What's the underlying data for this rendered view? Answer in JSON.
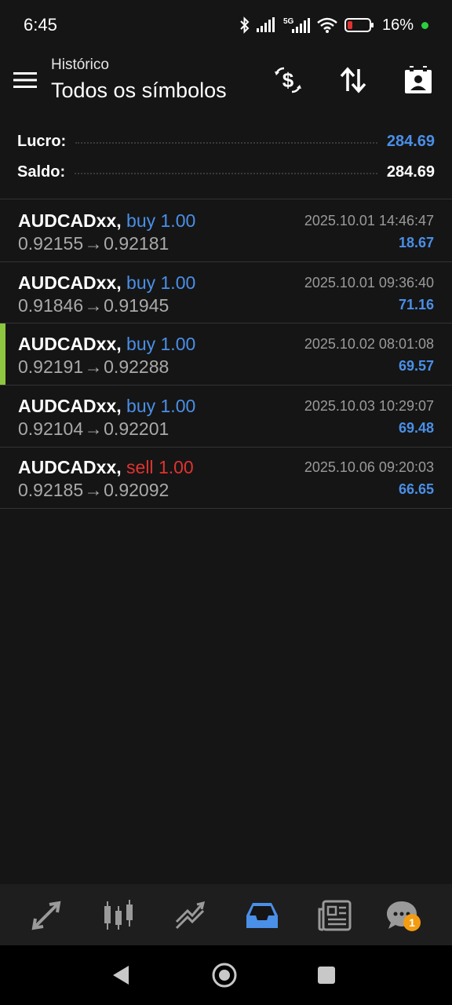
{
  "status_bar": {
    "time": "6:45",
    "battery": "16%"
  },
  "header": {
    "subtitle": "Histórico",
    "title": "Todos os símbolos"
  },
  "summary": {
    "profit_label": "Lucro:",
    "profit_value": "284.69",
    "balance_label": "Saldo:",
    "balance_value": "284.69"
  },
  "trades": [
    {
      "symbol": "AUDCADxx,",
      "type": "buy",
      "volume": "1.00",
      "open_price": "0.92155",
      "close_price": "0.92181",
      "time": "2025.10.01 14:46:47",
      "profit": "18.67"
    },
    {
      "symbol": "AUDCADxx,",
      "type": "buy",
      "volume": "1.00",
      "open_price": "0.91846",
      "close_price": "0.91945",
      "time": "2025.10.01 09:36:40",
      "profit": "71.16"
    },
    {
      "symbol": "AUDCADxx,",
      "type": "buy",
      "volume": "1.00",
      "open_price": "0.92191",
      "close_price": "0.92288",
      "time": "2025.10.02 08:01:08",
      "profit": "69.57"
    },
    {
      "symbol": "AUDCADxx,",
      "type": "buy",
      "volume": "1.00",
      "open_price": "0.92104",
      "close_price": "0.92201",
      "time": "2025.10.03 10:29:07",
      "profit": "69.48"
    },
    {
      "symbol": "AUDCADxx,",
      "type": "sell",
      "volume": "1.00",
      "open_price": "0.92185",
      "close_price": "0.92092",
      "time": "2025.10.06 09:20:03",
      "profit": "66.65"
    }
  ],
  "arrow_glyph": "→",
  "bottom_nav": {
    "items": [
      "quotes-icon",
      "chart-icon",
      "trade-icon",
      "history-icon",
      "news-icon",
      "chat-icon"
    ],
    "active": "history-icon",
    "chat_badge": "1"
  },
  "colors": {
    "accent": "#4a8fe8",
    "sell": "#e0332f",
    "selected": "#8dc63f",
    "background": "#151515"
  }
}
